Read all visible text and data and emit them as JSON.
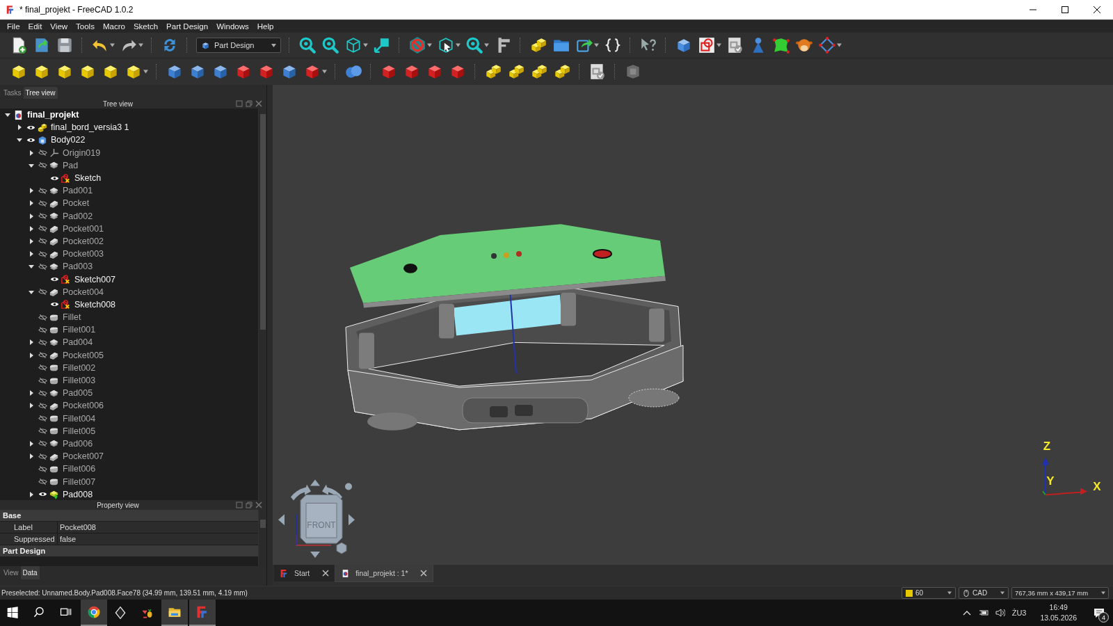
{
  "window": {
    "title": "* final_projekt - FreeCAD 1.0.2"
  },
  "menu": [
    "File",
    "Edit",
    "View",
    "Tools",
    "Macro",
    "Sketch",
    "Part Design",
    "Windows",
    "Help"
  ],
  "workbench": {
    "label": "Part Design"
  },
  "panel_tabs": [
    {
      "label": "Tasks",
      "selected": false
    },
    {
      "label": "Tree view",
      "selected": true
    }
  ],
  "tree_view": {
    "title": "Tree view",
    "items": [
      {
        "label": "final_projekt",
        "kind": "document",
        "expanded": true,
        "children": [
          {
            "label": "final_bord_versia3 1",
            "kind": "part",
            "visible": true,
            "expanded": false
          },
          {
            "label": "Body022",
            "kind": "body",
            "visible": true,
            "expanded": true,
            "children": [
              {
                "label": "Origin019",
                "kind": "origin",
                "visible": false,
                "expanded": false
              },
              {
                "label": "Pad",
                "kind": "pad",
                "visible": false,
                "expanded": true,
                "children": [
                  {
                    "label": "Sketch",
                    "kind": "sketch",
                    "visible": true
                  }
                ]
              },
              {
                "label": "Pad001",
                "kind": "pad",
                "visible": false,
                "expanded": false
              },
              {
                "label": "Pocket",
                "kind": "pocket",
                "visible": false,
                "expanded": false
              },
              {
                "label": "Pad002",
                "kind": "pad",
                "visible": false,
                "expanded": false
              },
              {
                "label": "Pocket001",
                "kind": "pocket",
                "visible": false,
                "expanded": false
              },
              {
                "label": "Pocket002",
                "kind": "pocket",
                "visible": false,
                "expanded": false
              },
              {
                "label": "Pocket003",
                "kind": "pocket",
                "visible": false,
                "expanded": false
              },
              {
                "label": "Pad003",
                "kind": "pad",
                "visible": false,
                "expanded": true,
                "children": [
                  {
                    "label": "Sketch007",
                    "kind": "sketch",
                    "visible": true
                  }
                ]
              },
              {
                "label": "Pocket004",
                "kind": "pocket",
                "visible": false,
                "expanded": true,
                "children": [
                  {
                    "label": "Sketch008",
                    "kind": "sketch",
                    "visible": true
                  }
                ]
              },
              {
                "label": "Fillet",
                "kind": "fillet",
                "visible": false
              },
              {
                "label": "Fillet001",
                "kind": "fillet",
                "visible": false
              },
              {
                "label": "Pad004",
                "kind": "pad",
                "visible": false,
                "expanded": false
              },
              {
                "label": "Pocket005",
                "kind": "pocket",
                "visible": false,
                "expanded": false
              },
              {
                "label": "Fillet002",
                "kind": "fillet",
                "visible": false
              },
              {
                "label": "Fillet003",
                "kind": "fillet",
                "visible": false
              },
              {
                "label": "Pad005",
                "kind": "pad",
                "visible": false,
                "expanded": false
              },
              {
                "label": "Pocket006",
                "kind": "pocket",
                "visible": false,
                "expanded": false
              },
              {
                "label": "Fillet004",
                "kind": "fillet",
                "visible": false
              },
              {
                "label": "Fillet005",
                "kind": "fillet",
                "visible": false
              },
              {
                "label": "Pad006",
                "kind": "pad",
                "visible": false,
                "expanded": false
              },
              {
                "label": "Pocket007",
                "kind": "pocket",
                "visible": false,
                "expanded": false
              },
              {
                "label": "Fillet006",
                "kind": "fillet",
                "visible": false
              },
              {
                "label": "Fillet007",
                "kind": "fillet",
                "visible": false
              },
              {
                "label": "Pad008",
                "kind": "tip",
                "visible": true,
                "expanded": false
              }
            ]
          }
        ]
      }
    ]
  },
  "property_view": {
    "title": "Property view",
    "groups": [
      {
        "name": "Base",
        "rows": [
          {
            "property": "Label",
            "value": "Pocket008"
          },
          {
            "property": "Suppressed",
            "value": "false"
          }
        ]
      },
      {
        "name": "Part Design"
      }
    ]
  },
  "property_tabs": [
    {
      "label": "View",
      "selected": false
    },
    {
      "label": "Data",
      "selected": true
    }
  ],
  "viewport": {
    "cube_face": "FRONT",
    "axes": [
      "Z",
      "Y",
      "X"
    ]
  },
  "document_tabs": [
    {
      "label": "Start",
      "kind": "start",
      "selected": false
    },
    {
      "label": "final_projekt : 1*",
      "kind": "document",
      "selected": true
    }
  ],
  "status_bar": {
    "message": "Preselected: Unnamed.Body.Pad008.Face78 (34.99 mm, 139.51 mm, 4.19 mm)",
    "draw_style": "60",
    "navigation": "CAD",
    "dimensions": "767,36 mm x 439,17 mm"
  },
  "taskbar": {
    "language": "ŻU3",
    "time": "16:49",
    "date": "13.05.2026",
    "notifications": "4"
  }
}
